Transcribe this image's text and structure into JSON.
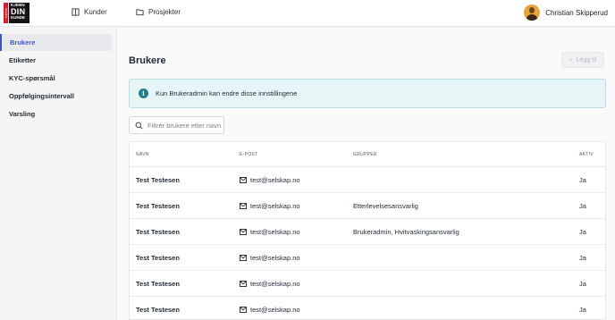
{
  "logo": {
    "side_text": "Modulus",
    "line1": "KJENN",
    "line2": "DIN",
    "line3": "KUNDE",
    "colors": {
      "red": "#d6202a",
      "dark": "#151515"
    }
  },
  "nav": [
    {
      "label": "Kunder",
      "icon": "book-icon"
    },
    {
      "label": "Prosjekter",
      "icon": "folder-icon"
    }
  ],
  "user": {
    "name": "Christian Skipperud"
  },
  "sidebar": {
    "items": [
      {
        "label": "Brukere",
        "active": true
      },
      {
        "label": "Etiketter"
      },
      {
        "label": "KYC-spørsmål"
      },
      {
        "label": "Oppfølgingsintervall"
      },
      {
        "label": "Varsling"
      }
    ]
  },
  "main": {
    "title": "Brukere",
    "add_button": "Legg til",
    "info": "Kun Brukeradmin kan endre disse innstillingene",
    "search_placeholder": "Filtrér brukere etter navn"
  },
  "table": {
    "headers": {
      "name": "NAVN",
      "email": "E-POST",
      "groups": "GRUPPER",
      "active": "AKTIV"
    },
    "rows": [
      {
        "name": "Test Testesen",
        "email": "test@selskap.no",
        "groups": "",
        "active": "Ja"
      },
      {
        "name": "Test Testesen",
        "email": "test@selskap.no",
        "groups": "Etterlevelsesansvarlig",
        "active": "Ja"
      },
      {
        "name": "Test Testesen",
        "email": "test@selskap.no",
        "groups": "Brukeradmin, Hvitvaskingsansvarlig",
        "active": "Ja"
      },
      {
        "name": "Test Testesen",
        "email": "test@selskap.no",
        "groups": "",
        "active": "Ja"
      },
      {
        "name": "Test Testesen",
        "email": "test@selskap.no",
        "groups": "",
        "active": "Ja"
      },
      {
        "name": "Test Testesen",
        "email": "test@selskap.no",
        "groups": "",
        "active": "Ja"
      }
    ]
  },
  "colors": {
    "accent": "#3f58c6",
    "info_bg": "#e8f5f6",
    "info_border": "#b9dfe3",
    "info_icon": "#1e7f8a"
  }
}
